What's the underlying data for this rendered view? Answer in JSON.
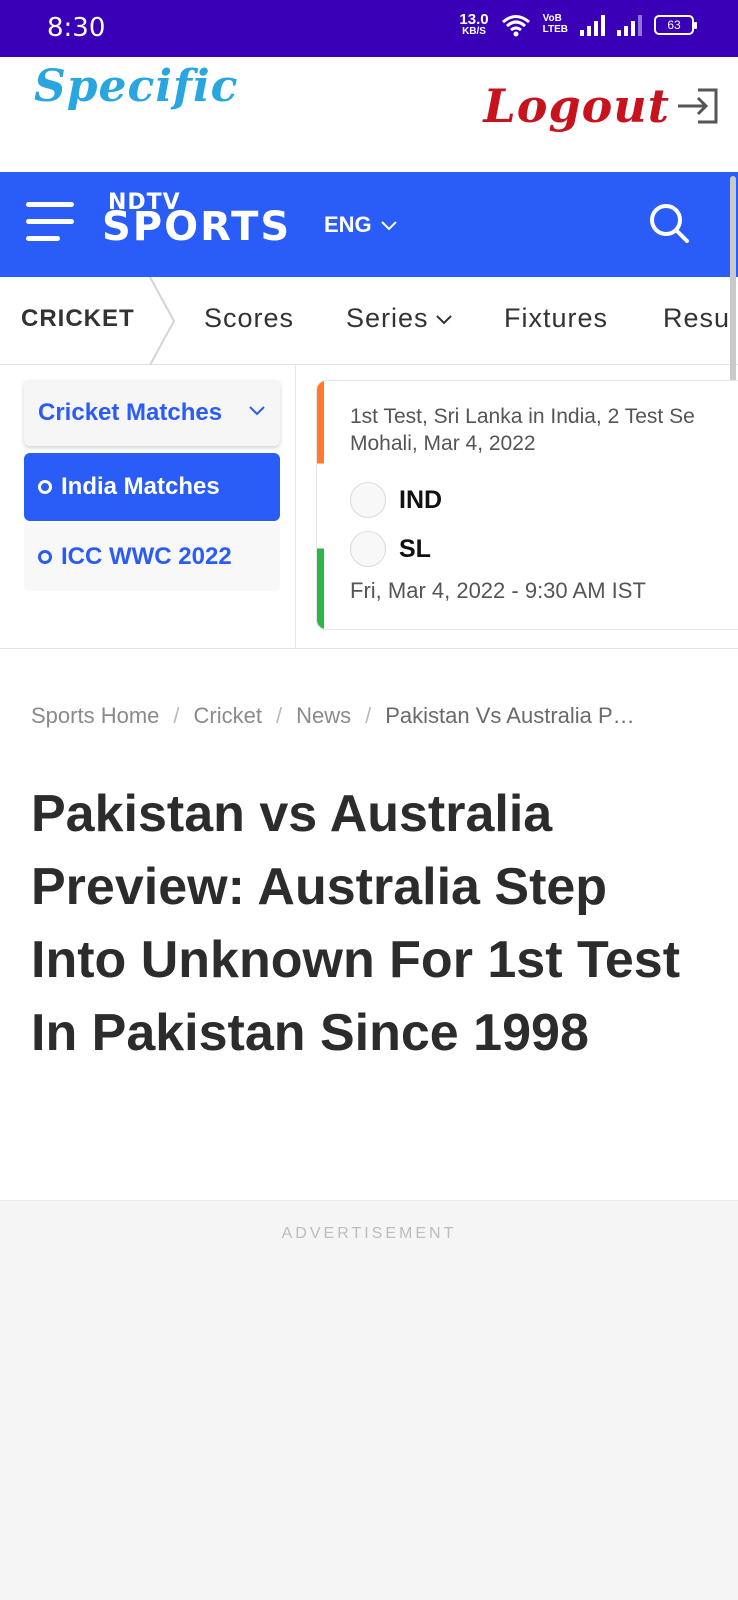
{
  "status_bar": {
    "time": "8:30",
    "net_speed_value": "13.0",
    "net_speed_unit": "KB/S",
    "volte_top": "VoB",
    "volte_bottom": "LTEB",
    "battery": "63"
  },
  "app_header": {
    "brand": "Specific",
    "logout_label": "Logout"
  },
  "site_header": {
    "logo_top": "NDTV",
    "logo_bottom": "SPORTS",
    "language": "ENG",
    "brand_color": "#2a5cf7"
  },
  "nav": {
    "home": "CRICKET",
    "tabs": [
      {
        "label": "Scores"
      },
      {
        "label": "Series"
      },
      {
        "label": "Fixtures"
      },
      {
        "label": "Resul"
      }
    ]
  },
  "scores_widget": {
    "dropdown_label": "Cricket Matches",
    "filters": [
      {
        "label": "India Matches",
        "active": true
      },
      {
        "label": "ICC WWC 2022",
        "active": false
      }
    ],
    "match": {
      "title_line1": "1st Test, Sri Lanka in India, 2 Test Se",
      "title_line2": "Mohali, Mar 4, 2022",
      "teams": [
        {
          "name": "IND"
        },
        {
          "name": "SL"
        }
      ],
      "datetime": "Fri, Mar 4, 2022 - 9:30 AM IST"
    }
  },
  "breadcrumb": {
    "items": [
      "Sports Home",
      "Cricket",
      "News"
    ],
    "current": "Pakistan Vs Australia P…"
  },
  "article": {
    "headline": "Pakistan vs Australia Preview: Australia Step Into Unknown For 1st Test In Pakistan Since 1998"
  },
  "ad": {
    "label": "ADVERTISEMENT"
  }
}
